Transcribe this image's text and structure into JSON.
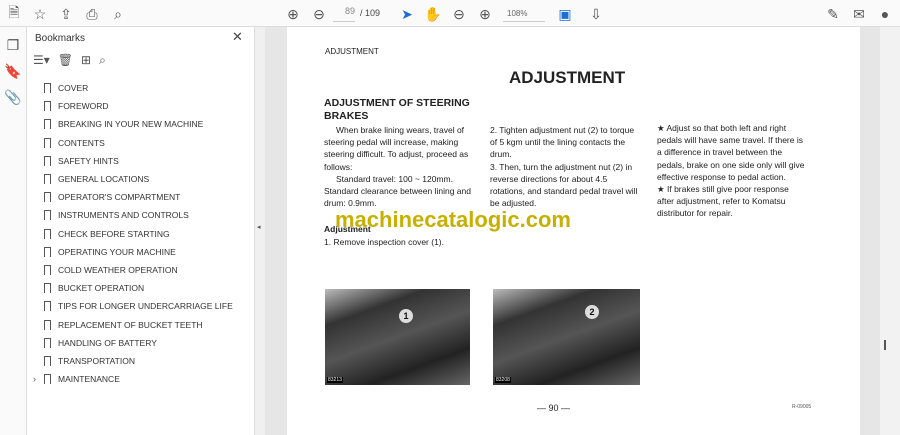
{
  "toolbar": {
    "page_current": "89",
    "page_total": "/ 109",
    "zoom": "108%"
  },
  "bookmarks": {
    "title": "Bookmarks",
    "items": [
      {
        "label": "COVER"
      },
      {
        "label": "FOREWORD"
      },
      {
        "label": "BREAKING IN YOUR NEW MACHINE"
      },
      {
        "label": "CONTENTS"
      },
      {
        "label": "SAFETY HINTS"
      },
      {
        "label": "GENERAL LOCATIONS"
      },
      {
        "label": "OPERATOR'S COMPARTMENT"
      },
      {
        "label": "INSTRUMENTS AND CONTROLS"
      },
      {
        "label": "CHECK BEFORE STARTING"
      },
      {
        "label": "OPERATING YOUR MACHINE"
      },
      {
        "label": "COLD WEATHER OPERATION"
      },
      {
        "label": "BUCKET OPERATION"
      },
      {
        "label": "TIPS FOR LONGER UNDERCARRIAGE LIFE"
      },
      {
        "label": "REPLACEMENT OF BUCKET TEETH"
      },
      {
        "label": "HANDLING OF BATTERY"
      },
      {
        "label": "TRANSPORTATION"
      },
      {
        "label": "MAINTENANCE"
      }
    ]
  },
  "page": {
    "header": "ADJUSTMENT",
    "title": "ADJUSTMENT",
    "section_title": "ADJUSTMENT OF STEERING BRAKES",
    "col1": [
      "When brake lining wears, travel of steering pedal will increase, making steering difficult. To adjust, proceed as follows:",
      "Standard travel: 100 ~ 120mm.",
      "Standard clearance between lining and drum: 0.9mm.",
      "Adjustment",
      "1. Remove inspection cover (1)."
    ],
    "col2": [
      "2. Tighten adjustment nut (2) to torque of 5 kgm until the lining contacts the drum.",
      "3. Then, turn the adjustment nut (2) in reverse directions for about 4.5 rotations, and standard pedal travel will be adjusted."
    ],
    "col3": [
      "★ Adjust so that both left and right pedals will have same travel. If there is a difference in travel between the pedals, brake on one side only will give effective response to pedal action.",
      "★ If brakes still give poor response after adjustment, refer to Komatsu distributor for repair."
    ],
    "watermark": "machinecatalogic.com",
    "photo1": {
      "callout": "1",
      "tag": "83213"
    },
    "photo2": {
      "callout": "2",
      "tag": "83208"
    },
    "page_number": "— 90 —",
    "code": "R-09005"
  }
}
